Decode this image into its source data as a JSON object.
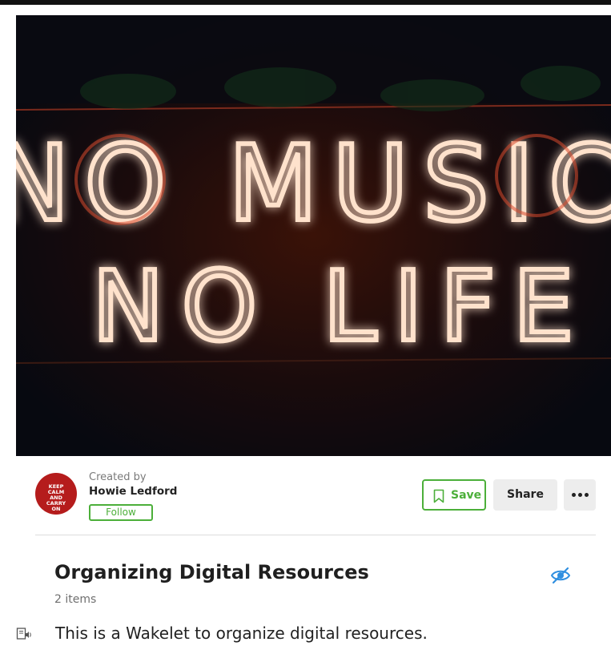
{
  "hero_image": {
    "alt": "",
    "neon_line_1": "NO MUSIC",
    "neon_line_2": "NO LIFE",
    "neon_color": "#ff6a4a"
  },
  "creator": {
    "created_by_label": "Created by",
    "name": "Howie Ledford",
    "follow_label": "Follow",
    "avatar_text": [
      "KEEP",
      "CALM",
      "AND",
      "CARRY",
      "ON"
    ]
  },
  "actions": {
    "save_label": "Save",
    "share_label": "Share",
    "more_icon": "more-horizontal-icon"
  },
  "collection": {
    "title": "Organizing Digital Resources",
    "item_count": "2 items",
    "visibility_icon": "eye-off-icon",
    "description": "This is a Wakelet to organize digital resources."
  },
  "colors": {
    "accent_green": "#4caf3a",
    "visibility_blue": "#2f8fe0",
    "avatar_red": "#b51c1c"
  }
}
